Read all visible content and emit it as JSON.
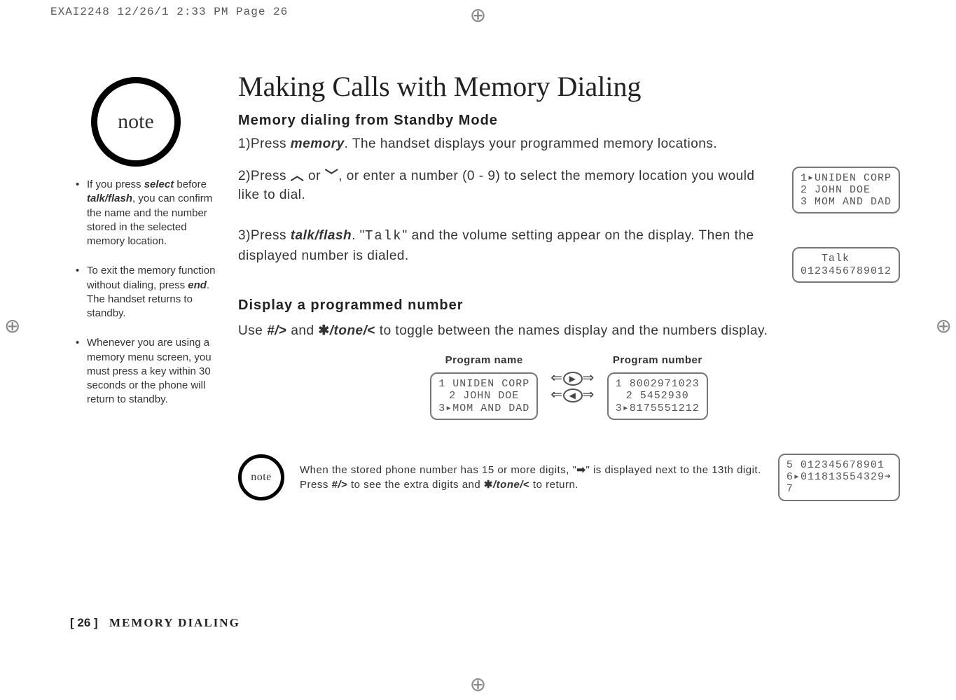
{
  "printHeader": "EXAI2248  12/26/1 2:33 PM  Page 26",
  "noteLabel": "note",
  "aside": {
    "items": [
      {
        "pre": "If you press ",
        "b1": "select",
        "mid": " before ",
        "b2": "talk/flash",
        "post": ", you can confirm the name and the number stored in the selected memory location."
      },
      {
        "pre": "To exit the memory function without dialing, press ",
        "b1": "end",
        "mid": ". The handset returns to standby.",
        "b2": "",
        "post": ""
      },
      {
        "pre": "Whenever you are using a memory menu screen, you must press a key within 30 seconds or the phone will return to standby.",
        "b1": "",
        "mid": "",
        "b2": "",
        "post": ""
      }
    ]
  },
  "title": "Making Calls with Memory Dialing",
  "h2a": "Memory dialing from Standby Mode",
  "step1": {
    "lead": "1)Press ",
    "key": "memory",
    "tail": ". The handset displays your programmed memory locations."
  },
  "step2": {
    "lead": "2)Press ",
    "up": "︿",
    "or": " or ",
    "down": "﹀",
    "tail": ", or enter a number (0 - 9) to select the memory location you would like to dial."
  },
  "lcd1": "1▸UNIDEN CORP\n2 JOHN DOE\n3 MOM AND DAD",
  "step3": {
    "lead": "3)Press ",
    "key": "talk/flash",
    "mid": ". \"",
    "code": "Talk",
    "tail": "\" and the volume setting appear on the display. Then the displayed number is dialed."
  },
  "lcd2": "   Talk\n0123456789012",
  "h2b": "Display a programmed number",
  "toggleLine": {
    "pre": "Use ",
    "k1": "#/",
    "g1": ">",
    "mid": " and ",
    "star": "✱",
    "k2": "/tone/",
    "g2": "<",
    "post": " to toggle between the names display and the numbers display."
  },
  "compare": {
    "leftCaption": "Program name",
    "rightCaption": "Program number",
    "leftLcd": "1 UNIDEN CORP\n2 JOHN DOE\n3▸MOM AND DAD",
    "arrowRight": "▶",
    "arrowLeft": "◀",
    "rightLcd": "1 8002971023\n2 5452930\n3▸8175551212"
  },
  "bottomNote": {
    "p1": "When the stored phone number has 15 or more digits, \"",
    "arrow": "➡",
    "p2": "\" is displayed next to the 13th digit. Press ",
    "k1": "#/",
    "g1": ">",
    "p3": " to see the extra digits and ",
    "star": "✱",
    "k2": "/tone/",
    "g2": "<",
    "p4": " to return."
  },
  "lcd3": "5 012345678901\n6▸011813554329➔\n7",
  "footer": {
    "num": "[ 26 ]",
    "section": "MEMORY DIALING"
  }
}
